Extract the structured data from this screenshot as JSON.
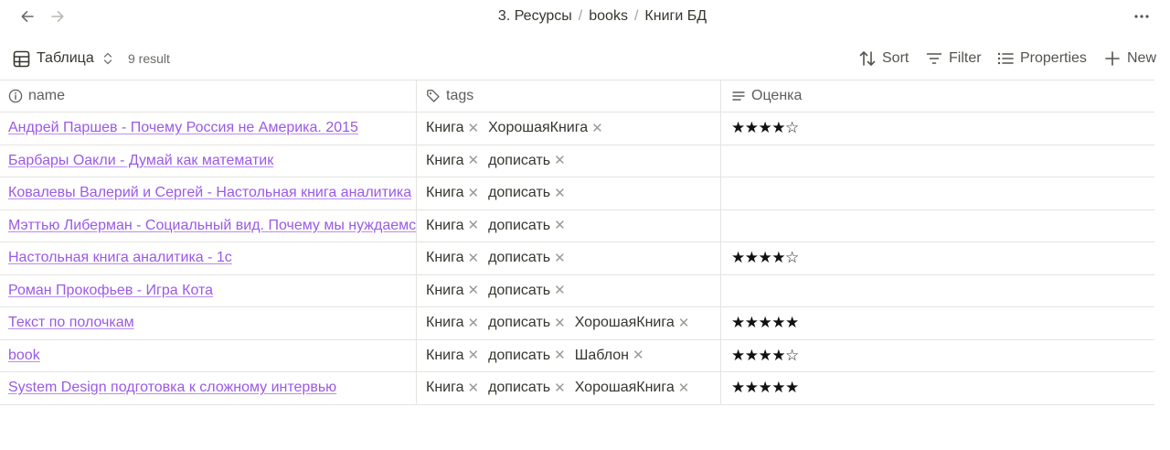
{
  "breadcrumb": [
    "3. Ресурсы",
    "books",
    "Книги БД"
  ],
  "toolbar": {
    "view_label": "Таблица",
    "result_count": "9 result",
    "sort_label": "Sort",
    "filter_label": "Filter",
    "properties_label": "Properties",
    "new_label": "New"
  },
  "columns": {
    "name": "name",
    "tags": "tags",
    "rating": "Оценка"
  },
  "rows": [
    {
      "name": "Андрей Паршев - Почему Россия не Америка. 2015",
      "tags": [
        "Книга",
        "ХорошаяКнига"
      ],
      "rating": 4
    },
    {
      "name": "Барбары Оакли - Думай как математик",
      "tags": [
        "Книга",
        "дописать"
      ],
      "rating": 0
    },
    {
      "name": "Ковалевы Валерий и Сергей - Настольная книга аналитика",
      "tags": [
        "Книга",
        "дописать"
      ],
      "rating": 0
    },
    {
      "name": "Мэттью Либерман - Социальный вид. Почему мы нуждаемся",
      "tags": [
        "Книга",
        "дописать"
      ],
      "rating": 0
    },
    {
      "name": "Настольная книга аналитика - 1с",
      "tags": [
        "Книга",
        "дописать"
      ],
      "rating": 4
    },
    {
      "name": "Роман Прокофьев - Игра Кота",
      "tags": [
        "Книга",
        "дописать"
      ],
      "rating": 0
    },
    {
      "name": "Текст по полочкам",
      "tags": [
        "Книга",
        "дописать",
        "ХорошаяКнига"
      ],
      "rating": 5
    },
    {
      "name": "book",
      "tags": [
        "Книга",
        "дописать",
        "Шаблон"
      ],
      "rating": 4
    },
    {
      "name": "System Design подготовка к сложному интервью",
      "tags": [
        "Книга",
        "дописать",
        "ХорошаяКнига"
      ],
      "rating": 5
    }
  ],
  "rating_max": 5,
  "icons": {
    "back": "arrow-left-icon",
    "forward": "arrow-right-icon",
    "more": "more-horizontal-icon",
    "table": "table-icon",
    "sort": "sort-icon",
    "filter": "filter-icon",
    "properties": "list-icon",
    "new": "plus-icon",
    "name_column": "info-icon",
    "tags_column": "tag-icon",
    "rating_column": "text-lines-icon",
    "tag_remove": "close-icon"
  },
  "colors": {
    "link": "#9b59e6",
    "text": "#37352f",
    "muted": "#6b6a66",
    "border": "#e5e4e1"
  }
}
